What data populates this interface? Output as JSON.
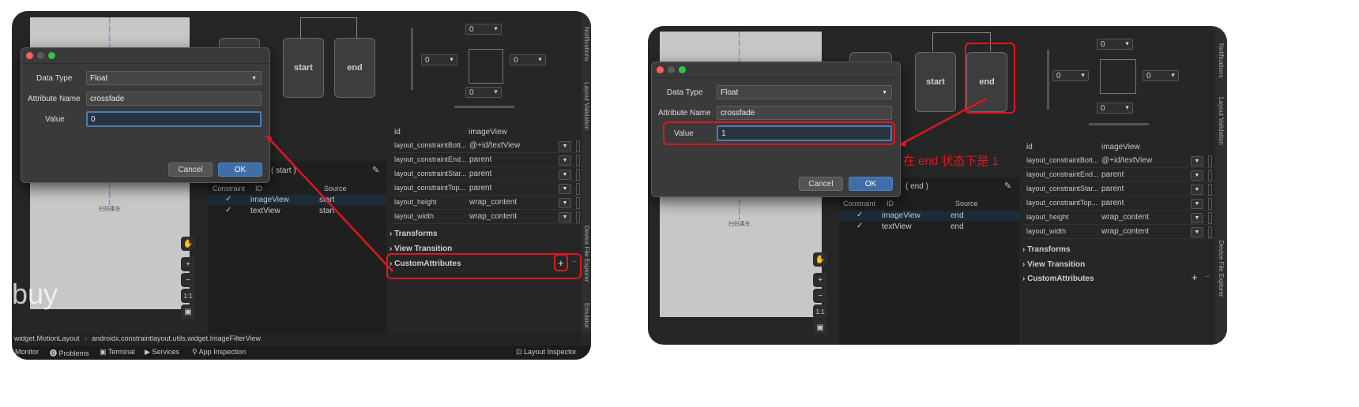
{
  "dialog": {
    "data_type_label": "Data Type",
    "data_type_value": "Float",
    "attribute_name_label": "Attribute Name",
    "attribute_name_value": "crossfade",
    "value_label": "Value",
    "cancel_label": "Cancel",
    "ok_label": "OK"
  },
  "left": {
    "value": "0",
    "state_start": "start",
    "state_end": "end",
    "tab_state": "( start )",
    "rows": [
      {
        "id": "imageView",
        "source": "start"
      },
      {
        "id": "textView",
        "source": "start"
      }
    ],
    "watermark": "buy",
    "breadcrumb_1": "widget.MotionLayout",
    "breadcrumb_2": "androidx.constraintlayout.utils.widget.ImageFilterView",
    "bottom_monitor": "Monitor",
    "bottom_problems": "Problems",
    "bottom_terminal": "Terminal",
    "bottom_services": "Services",
    "bottom_app_inspection": "App Inspection",
    "bottom_layout_inspector": "Layout Inspector"
  },
  "right": {
    "value": "1",
    "state_start": "start",
    "state_end": "end",
    "tab_state": "( end )",
    "rows": [
      {
        "id": "imageView",
        "source": "end"
      },
      {
        "id": "textView",
        "source": "end"
      }
    ],
    "annotation": "在 end 状态下是 1"
  },
  "common": {
    "constraint_col": "Constraint",
    "id_col": "ID",
    "source_col": "Source",
    "scan_label": "扫码乘车",
    "margin_zero": "0",
    "attr_header_id": "id",
    "attr_header_value": "imageView",
    "attrs": [
      {
        "name": "layout_constraintBott...",
        "value": "@+id/textView"
      },
      {
        "name": "layout_constraintEnd...",
        "value": "parent"
      },
      {
        "name": "layout_constraintStar...",
        "value": "parent"
      },
      {
        "name": "layout_constraintTop...",
        "value": "parent"
      },
      {
        "name": "layout_height",
        "value": "wrap_content"
      },
      {
        "name": "layout_width",
        "value": "wrap_content"
      }
    ],
    "section_transforms": "Transforms",
    "section_view_transition": "View Transition",
    "section_custom_attributes": "CustomAttributes",
    "plus": "+",
    "minus": "−",
    "zoom_in": "+",
    "zoom_out": "−",
    "zoom_ratio": "1:1",
    "side_notifications": "Notifications",
    "side_layout_validation": "Layout Validation",
    "side_device_file_explorer": "Device File Explorer",
    "side_emulator": "Emulator"
  },
  "colors": {
    "accent_red": "#e0161f",
    "focus_blue": "#4a7db8",
    "ok_blue": "#3f6ea8"
  }
}
